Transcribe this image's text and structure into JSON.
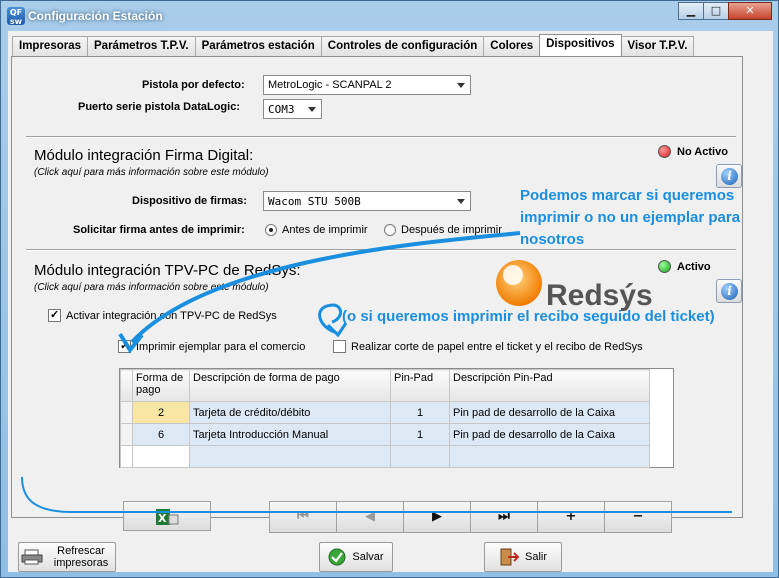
{
  "window": {
    "title": "Configuración Estación",
    "app_icon_text": "QF\nsw"
  },
  "tabs": [
    {
      "label": "Impresoras"
    },
    {
      "label": "Parámetros T.P.V."
    },
    {
      "label": "Parámetros estación"
    },
    {
      "label": "Controles de configuración"
    },
    {
      "label": "Colores"
    },
    {
      "label": "Dispositivos"
    },
    {
      "label": "Visor T.P.V."
    }
  ],
  "general": {
    "pistola_label": "Pistola por defecto:",
    "pistola_value": "MetroLogic - SCANPAL 2",
    "puerto_label": "Puerto serie pistola DataLogic:",
    "puerto_value": "COM3"
  },
  "firma": {
    "title": "Módulo integración Firma Digital:",
    "subtitle": "(Click aquí para más información sobre este módulo)",
    "status": "No Activo",
    "status_color": "#d61c1c",
    "dispositivo_label": "Dispositivo de firmas:",
    "dispositivo_value": "Wacom STU 500B",
    "solicitar_label": "Solicitar firma antes de imprimir:",
    "radio_antes": "Antes de imprimir",
    "radio_despues": "Después de imprimir"
  },
  "redsys": {
    "title": "Módulo integración TPV-PC de RedSys:",
    "subtitle": "(Click aquí para más información sobre este módulo)",
    "status": "Activo",
    "status_color": "#18a118",
    "logo_text": "Redsýs",
    "activar_label": "Activar integración con TPV-PC de RedSys",
    "imprimir_label": "Imprimir ejemplar para el comercio",
    "corte_label": "Realizar corte de papel entre el ticket y el recibo de RedSys"
  },
  "grid": {
    "headers": [
      "Forma de pago",
      "Descripción de forma de pago",
      "Pin-Pad",
      "Descripción Pin-Pad"
    ],
    "rows": [
      {
        "forma": "2",
        "descripcion": "Tarjeta de crédito/débito",
        "pinpad": "1",
        "desc_pinpad": "Pin pad de desarrollo de la Caixa"
      },
      {
        "forma": "6",
        "descripcion": "Tarjeta Introducción Manual",
        "pinpad": "1",
        "desc_pinpad": "Pin pad de desarrollo de la Caixa"
      }
    ]
  },
  "nav": {
    "first": "⏮",
    "prev": "◀",
    "next": "▶",
    "last": "⏭",
    "add": "+",
    "remove": "−"
  },
  "bottom": {
    "refrescar": "Refrescar impresoras",
    "salvar": "Salvar",
    "salir": "Salir"
  },
  "annotations": {
    "note1": "Podemos marcar si queremos imprimir o no un ejemplar para nosotros",
    "note2": "(o si queremos imprimir el recibo seguido del ticket)",
    "color": "#1a8fe0"
  }
}
